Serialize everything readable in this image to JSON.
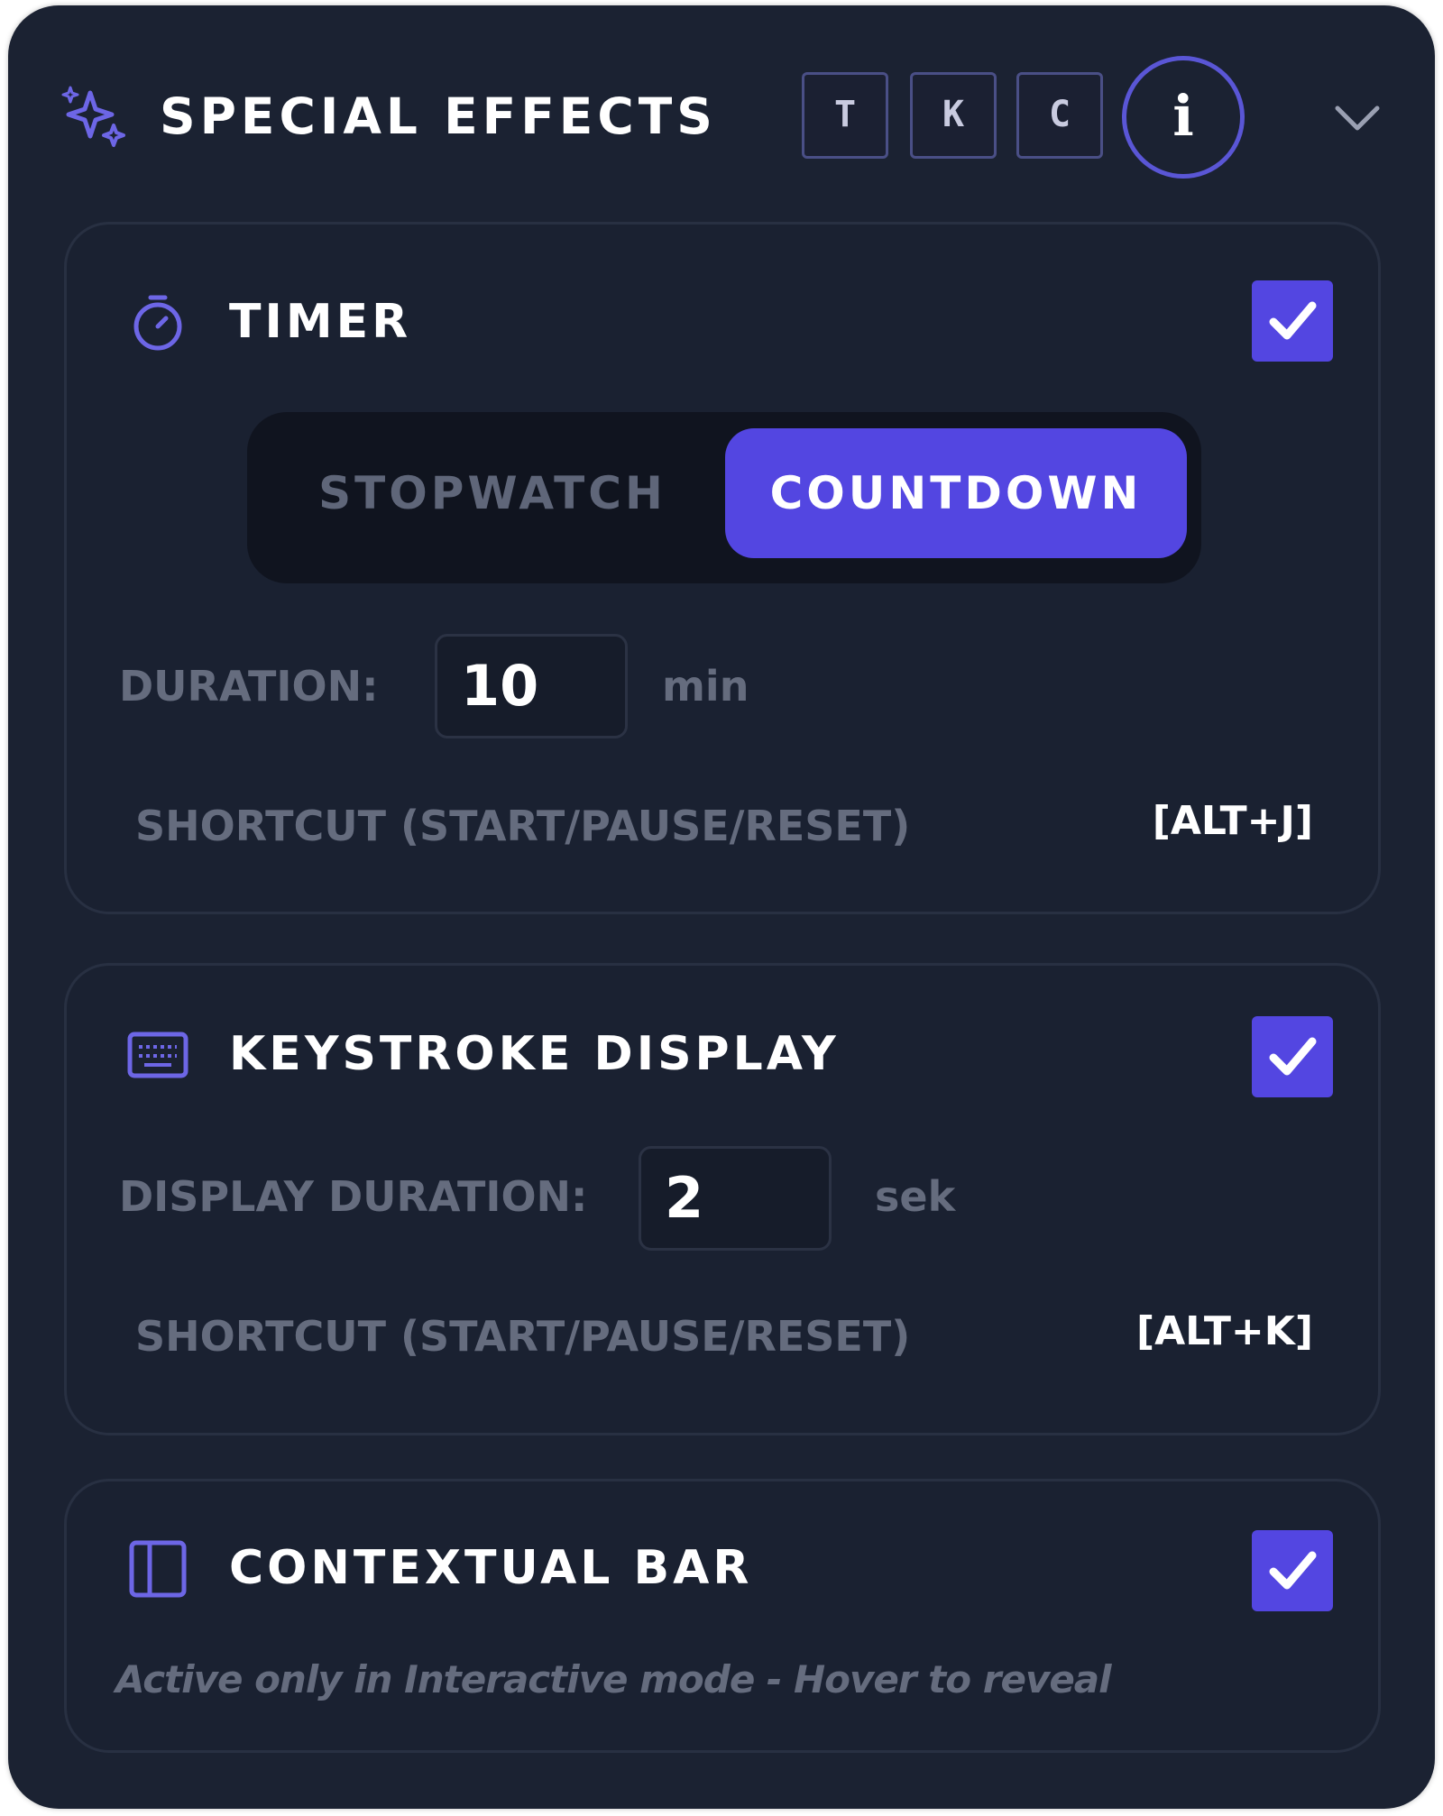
{
  "header": {
    "title": "SPECIAL EFFECTS",
    "icon": "sparkle-icon",
    "badges": [
      "T",
      "K",
      "C"
    ],
    "info_label": "i",
    "collapse_icon": "chevron-down-icon"
  },
  "timer": {
    "title": "TIMER",
    "icon": "stopwatch-icon",
    "enabled": true,
    "modes": [
      "STOPWATCH",
      "COUNTDOWN"
    ],
    "selected_mode": "COUNTDOWN",
    "duration_label": "DURATION:",
    "duration_value": "10",
    "duration_unit": "min",
    "shortcut_label": "SHORTCUT (START/PAUSE/RESET)",
    "shortcut_key": "[ALT+J]"
  },
  "keystroke": {
    "title": "KEYSTROKE DISPLAY",
    "icon": "keyboard-icon",
    "enabled": true,
    "duration_label": "DISPLAY DURATION:",
    "duration_value": "2",
    "duration_unit": "sek",
    "shortcut_label": "SHORTCUT (START/PAUSE/RESET)",
    "shortcut_key": "[ALT+K]"
  },
  "contextual_bar": {
    "title": "CONTEXTUAL BAR",
    "icon": "sidebar-layout-icon",
    "enabled": true,
    "note": "Active only in Interactive mode - Hover to reveal"
  },
  "colors": {
    "panel_bg": "#1b2232",
    "accent": "#5346e1",
    "muted_text": "#656c7e",
    "text": "#ffffff"
  }
}
